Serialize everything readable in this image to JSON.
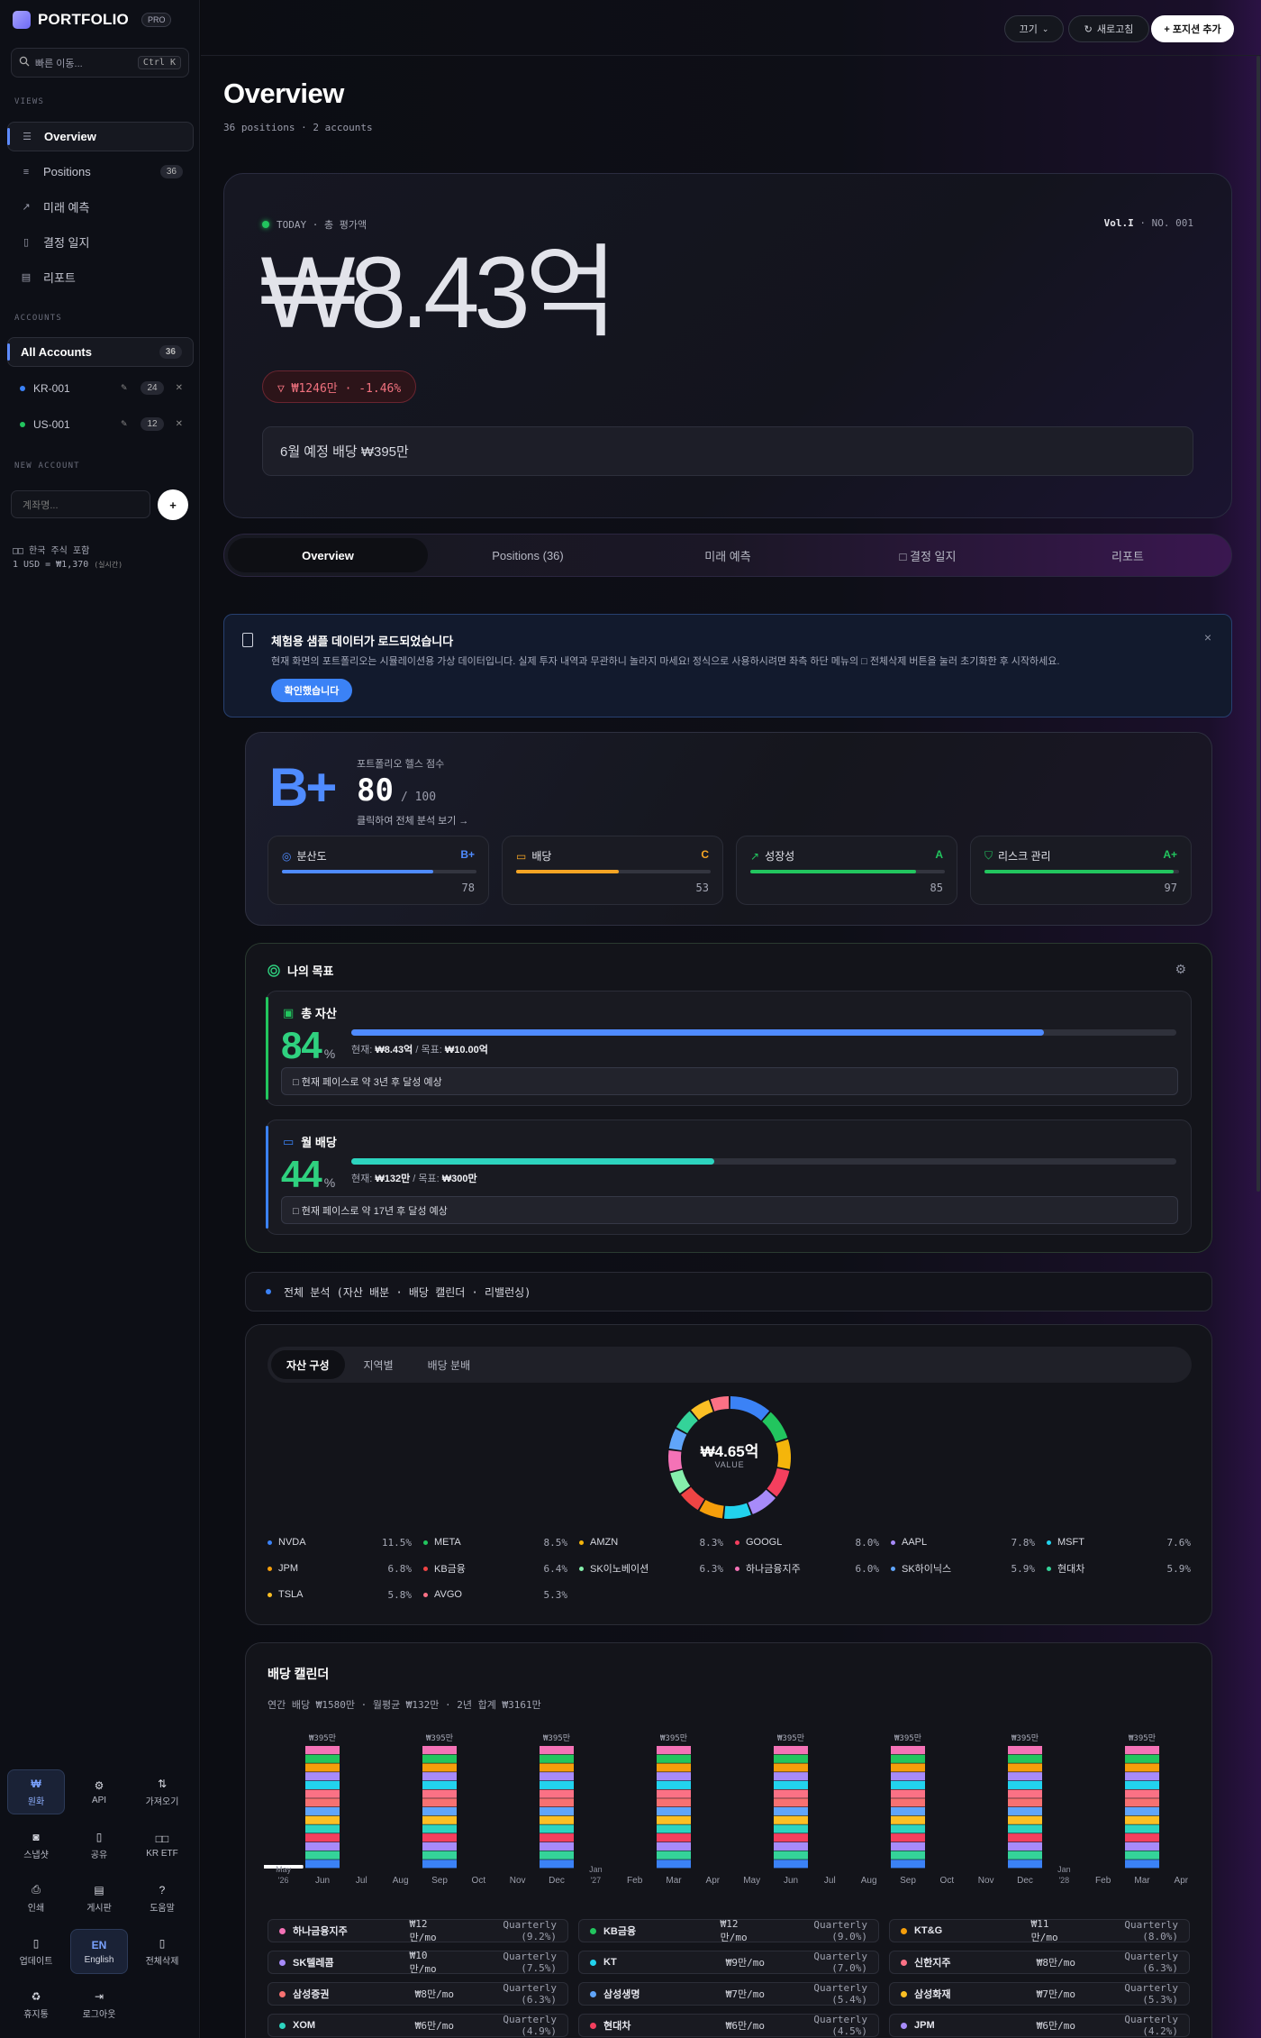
{
  "sidebar": {
    "brand": "PORTFOLIO",
    "badge": "PRO",
    "search_placeholder": "빠른 이동...",
    "search_kbd": "Ctrl K",
    "views_label": "VIEWS",
    "nav": [
      {
        "label": "Overview",
        "icon": "list-icon"
      },
      {
        "label": "Positions",
        "icon": "menu-icon",
        "count": "36"
      },
      {
        "label": "미래 예측",
        "icon": "trend-icon"
      },
      {
        "label": "결정 일지",
        "icon": "book-icon"
      },
      {
        "label": "리포트",
        "icon": "document-icon"
      }
    ],
    "accounts_label": "ACCOUNTS",
    "all_accounts": {
      "label": "All Accounts",
      "count": "36"
    },
    "accounts": [
      {
        "label": "KR-001",
        "count": "24",
        "color": "#3b82f6"
      },
      {
        "label": "US-001",
        "count": "12",
        "color": "#22c55e"
      }
    ],
    "new_account_label": "NEW ACCOUNT",
    "new_account_placeholder": "계좌명...",
    "new_account_button": "+",
    "market_line1": "□□ 한국 주식 포함",
    "market_line2": "1 USD = ₩1,370",
    "market_live": "(실시간)",
    "tools": [
      {
        "icon": "₩",
        "label": "원화",
        "active": true
      },
      {
        "icon": "⚙",
        "label": "API"
      },
      {
        "icon": "⇅",
        "label": "가져오기"
      },
      {
        "icon": "◙",
        "label": "스냅샷"
      },
      {
        "icon": "▯",
        "label": "공유"
      },
      {
        "icon": "□□",
        "label": "KR ETF"
      },
      {
        "icon": "⎙",
        "label": "인쇄"
      },
      {
        "icon": "▤",
        "label": "게시판"
      },
      {
        "icon": "?",
        "label": "도움말"
      },
      {
        "icon": "▯",
        "label": "업데이트"
      },
      {
        "icon": "EN",
        "label": "English",
        "active": true
      },
      {
        "icon": "▯",
        "label": "전체삭제"
      },
      {
        "icon": "♻",
        "label": "휴지통"
      },
      {
        "icon": "⇥",
        "label": "로그아웃"
      }
    ]
  },
  "topbar": {
    "select_value": "끄기",
    "refresh_label": "새로고침",
    "add_label": "+ 포지션 추가"
  },
  "overview": {
    "title": "Overview",
    "subtitle": "36 positions · 2 accounts"
  },
  "hero": {
    "today": "TODAY · 총 평가액",
    "vol": "Vol.I",
    "no": "· NO. 001",
    "value": "₩8.43억",
    "change": "▽ ₩1246만 · -1.46%",
    "dividend": "6월 예정 배당 ₩395만"
  },
  "tabs": [
    {
      "label": "Overview",
      "active": true
    },
    {
      "label": "Positions (36)"
    },
    {
      "label": "미래 예측"
    },
    {
      "label": "□ 결정 일지"
    },
    {
      "label": "리포트"
    }
  ],
  "notice": {
    "title": "체험용 샘플 데이터가 로드되었습니다",
    "desc": "현재 화면의 포트폴리오는 시뮬레이션용 가상 데이터입니다. 실제 투자 내역과 무관하니 놀라지 마세요! 정식으로 사용하시려면 좌측 하단 메뉴의 □ 전체삭제 버튼을 눌러 초기화한 후 시작하세요.",
    "button": "확인했습니다",
    "close": "×"
  },
  "health": {
    "grade": "B+",
    "label": "포트폴리오 헬스 점수",
    "score": "80",
    "max": "/ 100",
    "link": "클릭하여 전체 분석 보기 →",
    "metrics": [
      {
        "label": "분산도",
        "grade": "B+",
        "value": 78,
        "color": "#4f8bff",
        "icon": "target-icon"
      },
      {
        "label": "배당",
        "grade": "C",
        "value": 53,
        "color": "#f5a524",
        "icon": "cash-icon"
      },
      {
        "label": "성장성",
        "grade": "A",
        "value": 85,
        "color": "#22c55e",
        "icon": "trend-up-icon"
      },
      {
        "label": "리스크 관리",
        "grade": "A+",
        "value": 97,
        "color": "#22c55e",
        "icon": "shield-icon"
      }
    ]
  },
  "goals": {
    "title": "나의 목표",
    "items": [
      {
        "title": "총 자산",
        "percent": "84",
        "progress": 0.84,
        "current_label": "현재:",
        "current": "₩8.43억",
        "target_label": "목표:",
        "target": "₩10.00억",
        "note": "□ 현재 페이스로 약 3년 후 달성 예상",
        "color": "#22c55e",
        "bar": "#4f8bff",
        "icon": "wallet-icon"
      },
      {
        "title": "월 배당",
        "percent": "44",
        "progress": 0.44,
        "current_label": "현재:",
        "current": "₩132만",
        "target_label": "목표:",
        "target": "₩300만",
        "note": "□ 현재 페이스로 약 17년 후 달성 예상",
        "color": "#3b82f6",
        "bar": "#2dd4bf",
        "icon": "money-icon"
      }
    ]
  },
  "analysis_bar": "전체 분석 (자산 배분 · 배당 캘린더 · 리밸런싱)",
  "allocation": {
    "tabs": [
      "자산 구성",
      "지역별",
      "배당 분배"
    ],
    "center_value": "₩4.65억",
    "center_label": "VALUE",
    "legend": [
      {
        "name": "NVDA",
        "pct": "11.5%",
        "color": "#3b82f6"
      },
      {
        "name": "META",
        "pct": "8.5%",
        "color": "#22c55e"
      },
      {
        "name": "AMZN",
        "pct": "8.3%",
        "color": "#f5b50b"
      },
      {
        "name": "GOOGL",
        "pct": "8.0%",
        "color": "#f43f5e"
      },
      {
        "name": "AAPL",
        "pct": "7.8%",
        "color": "#a78bfa"
      },
      {
        "name": "MSFT",
        "pct": "7.6%",
        "color": "#22d3ee"
      },
      {
        "name": "JPM",
        "pct": "6.8%",
        "color": "#f59e0b"
      },
      {
        "name": "KB금융",
        "pct": "6.4%",
        "color": "#ef4444"
      },
      {
        "name": "SK이노베이션",
        "pct": "6.3%",
        "color": "#86efac"
      },
      {
        "name": "하나금융지주",
        "pct": "6.0%",
        "color": "#f472b6"
      },
      {
        "name": "SK하이닉스",
        "pct": "5.9%",
        "color": "#60a5fa"
      },
      {
        "name": "현대차",
        "pct": "5.9%",
        "color": "#34d399"
      },
      {
        "name": "TSLA",
        "pct": "5.8%",
        "color": "#fbbf24"
      },
      {
        "name": "AVGO",
        "pct": "5.3%",
        "color": "#fb7185"
      }
    ]
  },
  "calendar": {
    "title": "배당 캘린더",
    "summary": "연간 배당 ₩1580만 · 월평균 ₩132만 · 2년 합계 ₩3161만",
    "payers": [
      {
        "name": "하나금융지주",
        "monthly": "₩12만/mo",
        "freq": "Quarterly (9.2%)",
        "color": "#f472b6"
      },
      {
        "name": "KB금융",
        "monthly": "₩12만/mo",
        "freq": "Quarterly (9.0%)",
        "color": "#22c55e"
      },
      {
        "name": "KT&G",
        "monthly": "₩11만/mo",
        "freq": "Quarterly (8.0%)",
        "color": "#f59e0b"
      },
      {
        "name": "SK텔레콤",
        "monthly": "₩10만/mo",
        "freq": "Quarterly (7.5%)",
        "color": "#a78bfa"
      },
      {
        "name": "KT",
        "monthly": "₩9만/mo",
        "freq": "Quarterly (7.0%)",
        "color": "#22d3ee"
      },
      {
        "name": "신한지주",
        "monthly": "₩8만/mo",
        "freq": "Quarterly (6.3%)",
        "color": "#fb7185"
      },
      {
        "name": "삼성증권",
        "monthly": "₩8만/mo",
        "freq": "Quarterly (6.3%)",
        "color": "#f87171"
      },
      {
        "name": "삼성생명",
        "monthly": "₩7만/mo",
        "freq": "Quarterly (5.4%)",
        "color": "#60a5fa"
      },
      {
        "name": "삼성화재",
        "monthly": "₩7만/mo",
        "freq": "Quarterly (5.3%)",
        "color": "#fbbf24"
      },
      {
        "name": "XOM",
        "monthly": "₩6만/mo",
        "freq": "Quarterly (4.9%)",
        "color": "#2dd4bf"
      },
      {
        "name": "현대차",
        "monthly": "₩6만/mo",
        "freq": "Quarterly (4.5%)",
        "color": "#f43f5e"
      },
      {
        "name": "JPM",
        "monthly": "₩6만/mo",
        "freq": "Quarterly (4.2%)",
        "color": "#a78bfa"
      }
    ]
  },
  "chart_data": {
    "type": "bar",
    "title": "배당 캘린더",
    "categories": [
      "May '26",
      "Jun",
      "Jul",
      "Aug",
      "Sep",
      "Oct",
      "Nov",
      "Dec",
      "Jan '27",
      "Feb",
      "Mar",
      "Apr",
      "May",
      "Jun",
      "Jul",
      "Aug",
      "Sep",
      "Oct",
      "Nov",
      "Dec",
      "Jan '28",
      "Feb",
      "Mar",
      "Apr"
    ],
    "values": [
      40,
      395,
      0,
      0,
      395,
      0,
      0,
      395,
      0,
      0,
      395,
      0,
      0,
      395,
      0,
      0,
      395,
      0,
      0,
      395,
      0,
      0,
      395,
      0
    ],
    "data_labels": [
      "",
      "₩395만",
      "",
      "",
      "₩395만",
      "",
      "",
      "₩395만",
      "",
      "",
      "₩395만",
      "",
      "",
      "₩395만",
      "",
      "",
      "₩395만",
      "",
      "",
      "₩395만",
      "",
      "",
      "₩395만",
      ""
    ],
    "stack_colors": [
      "#f472b6",
      "#22c55e",
      "#f59e0b",
      "#a78bfa",
      "#22d3ee",
      "#fb7185",
      "#f87171",
      "#60a5fa",
      "#fbbf24",
      "#2dd4bf",
      "#f43f5e",
      "#a78bfa",
      "#34d399",
      "#3b82f6"
    ],
    "unit": "만원"
  }
}
